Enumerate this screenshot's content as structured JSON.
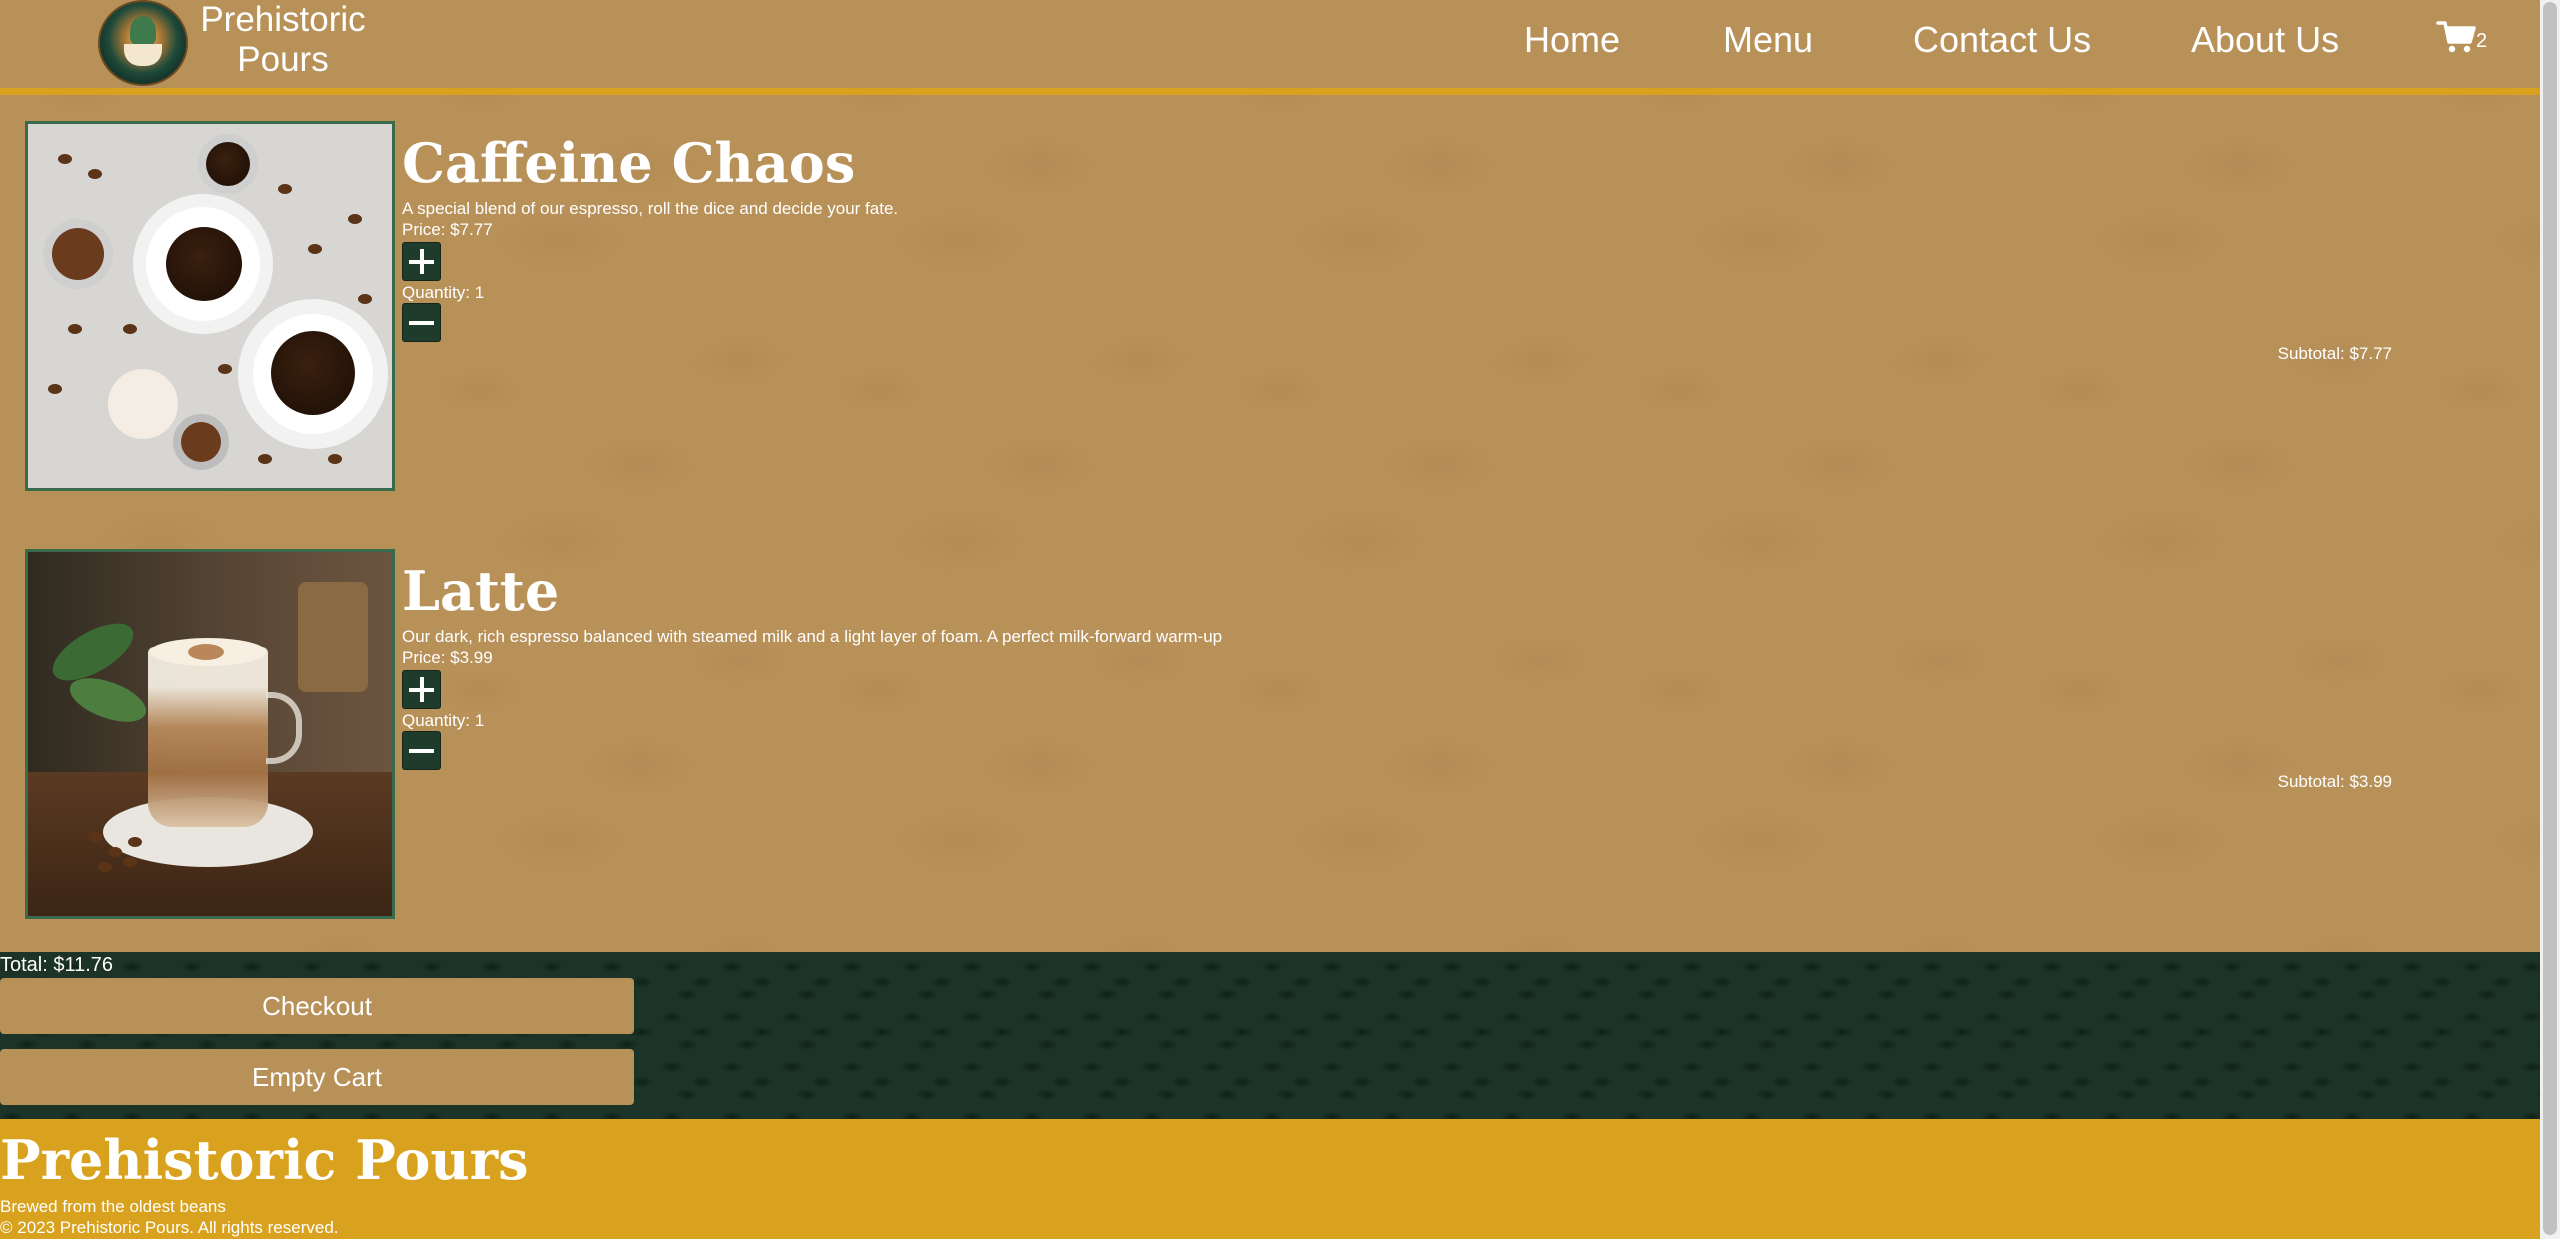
{
  "brand": {
    "name_line1": "Prehistoric",
    "name_line2": "Pours"
  },
  "nav": {
    "home": "Home",
    "menu": "Menu",
    "contact": "Contact Us",
    "about": "About Us",
    "cart_count": "2"
  },
  "cart": {
    "items": [
      {
        "title": "Caffeine Chaos",
        "description": "A special blend of our espresso, roll the dice and decide your fate.",
        "price": "Price: $7.77",
        "quantity": "Quantity: 1",
        "subtotal": "Subtotal: $7.77"
      },
      {
        "title": "Latte",
        "description": "Our dark, rich espresso balanced with steamed milk and a light layer of foam. A perfect milk-forward warm-up",
        "price": "Price: $3.99",
        "quantity": "Quantity: 1",
        "subtotal": "Subtotal: $3.99"
      }
    ],
    "total": "Total: $11.76",
    "checkout_label": "Checkout",
    "empty_label": "Empty Cart"
  },
  "footer": {
    "title": "Prehistoric Pours",
    "tagline": "Brewed from the oldest beans",
    "copyright": "© 2023 Prehistoric Pours. All rights reserved."
  },
  "colors": {
    "background": "#b89159",
    "accent_gold": "#d9a21e",
    "dark_green": "#1c3327",
    "button_green": "#1f3b2c"
  }
}
